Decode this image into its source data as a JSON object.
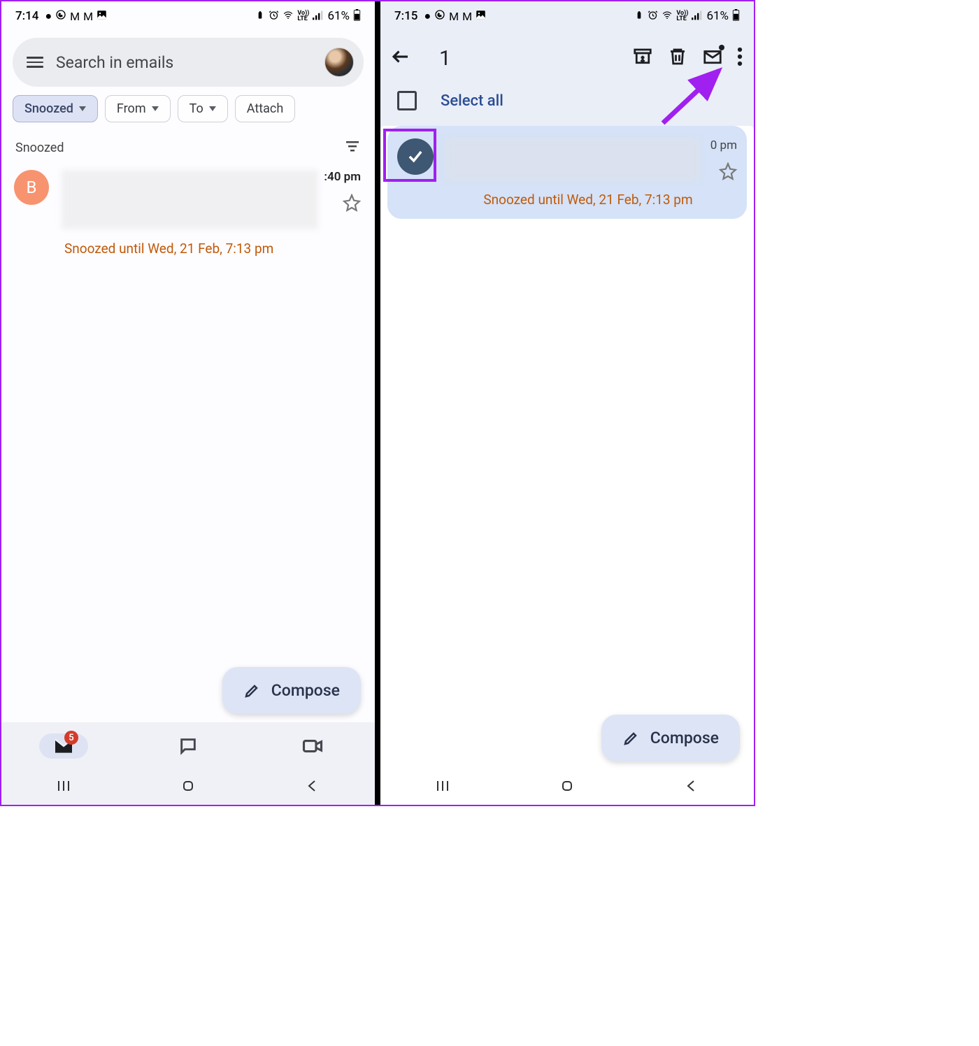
{
  "left": {
    "status": {
      "time": "7:14",
      "battery": "61%"
    },
    "search_placeholder": "Search in emails",
    "chips": {
      "snoozed": "Snoozed",
      "from": "From",
      "to": "To",
      "attachment": "Attach"
    },
    "section_title": "Snoozed",
    "email": {
      "sender_initial": "B",
      "time": ":40 pm",
      "snoozed_until": "Snoozed until Wed, 21 Feb, 7:13 pm"
    },
    "compose_label": "Compose",
    "badge_count": "5"
  },
  "right": {
    "status": {
      "time": "7:15",
      "battery": "61%"
    },
    "selected_count": "1",
    "select_all_label": "Select all",
    "email": {
      "time": "0 pm",
      "snoozed_until": "Snoozed until Wed, 21 Feb, 7:13 pm"
    },
    "compose_label": "Compose"
  }
}
